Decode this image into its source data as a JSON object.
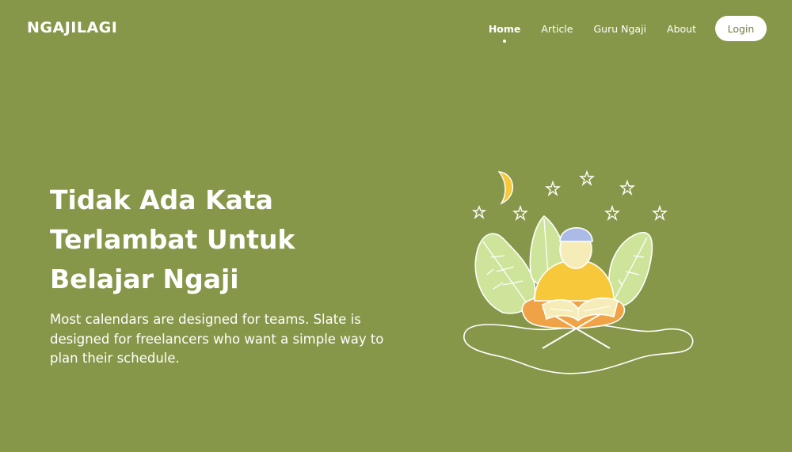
{
  "brand": {
    "name": "NGAJILAGI"
  },
  "nav": {
    "items": [
      {
        "label": "Home",
        "active": true
      },
      {
        "label": "Article",
        "active": false
      },
      {
        "label": "Guru Ngaji",
        "active": false
      },
      {
        "label": "About",
        "active": false
      }
    ],
    "login_label": "Login"
  },
  "hero": {
    "title_lines": [
      "Tidak Ada Kata",
      "Terlambat Untuk",
      "Belajar Ngaji"
    ],
    "description": "Most calendars are designed for teams. Slate is designed for freelancers who want a simple way to plan their schedule."
  },
  "colors": {
    "background": "#87974a",
    "text": "#ffffff",
    "login_text": "#6f7d3a",
    "leaf": "#cde49a",
    "shirt": "#f7c93a",
    "cap": "#a9bbe6",
    "skin": "#f6ecb8",
    "moon": "#f7c93a",
    "pants": "#f0a346"
  },
  "illustration": {
    "icon": "quran-reader-illustration"
  }
}
